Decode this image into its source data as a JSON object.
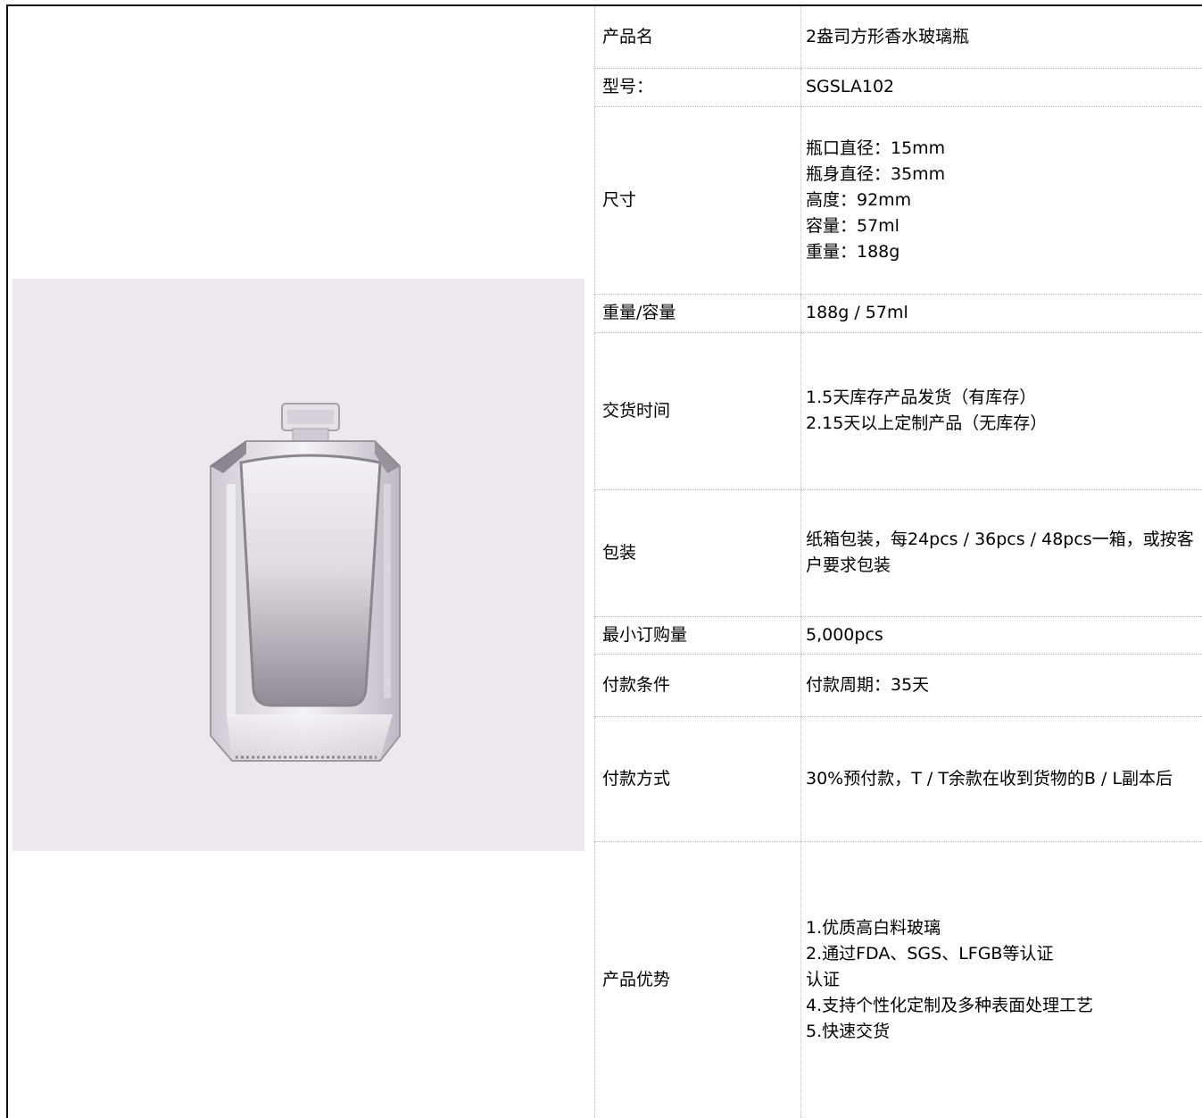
{
  "image": {
    "alt_icon": "perfume-bottle-image"
  },
  "rows": [
    {
      "label": "产品名",
      "lines": [
        "2盎司方形香水玻璃瓶"
      ]
    },
    {
      "label": "型号：",
      "lines": [
        "SGSLA102"
      ]
    },
    {
      "label": "尺寸",
      "lines": [
        "瓶口直径：15mm",
        "瓶身直径：35mm",
        "高度：92mm",
        "容量：57ml",
        "重量：188g"
      ]
    },
    {
      "label": "重量/容量",
      "lines": [
        "188g / 57ml"
      ]
    },
    {
      "label": "交货时间",
      "lines": [
        "1.5天库存产品发货（有库存）",
        "2.15天以上定制产品（无库存）"
      ]
    },
    {
      "label": "包装",
      "lines": [
        "纸箱包装，每24pcs / 36pcs / 48pcs一箱，或按客户要求包装"
      ]
    },
    {
      "label": "最小订购量",
      "lines": [
        "5,000pcs"
      ]
    },
    {
      "label": "付款条件",
      "lines": [
        "付款周期：35天"
      ]
    },
    {
      "label": "付款方式",
      "lines": [
        "30%预付款，T / T余款在收到货物的B / L副本后"
      ]
    },
    {
      "label": "产品优势",
      "lines": [
        "1.优质高白料玻璃",
        "2.通过FDA、SGS、LFGB等认证",
        "认证",
        "4.支持个性化定制及多种表面处理工艺",
        "5.快速交货"
      ]
    }
  ]
}
